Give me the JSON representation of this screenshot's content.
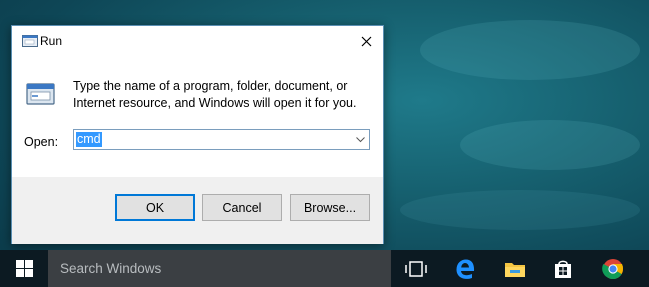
{
  "dialog": {
    "title": "Run",
    "description": "Type the name of a program, folder, document, or Internet resource, and Windows will open it for you.",
    "open_label": "Open:",
    "open_value": "cmd",
    "ok_label": "OK",
    "cancel_label": "Cancel",
    "browse_label": "Browse..."
  },
  "taskbar": {
    "search_placeholder": "Search Windows",
    "icons": [
      "windows-start-icon",
      "task-view-icon",
      "edge-icon",
      "file-explorer-icon",
      "store-icon",
      "chrome-icon"
    ]
  },
  "colors": {
    "accent": "#0078d7",
    "selection": "#3399ff",
    "taskbar": "#0c1a22",
    "search_box": "#3b3f43"
  }
}
